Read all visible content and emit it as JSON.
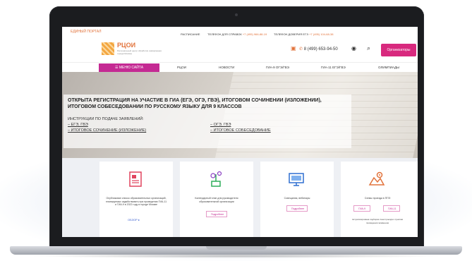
{
  "topbar": {
    "tagline": "ЕДИНЫЙ ПОРТАЛ",
    "schedule": "РАСПИСАНИЕ",
    "hotline_label": "ТЕЛЕФОН ДЛЯ СПРАВОК",
    "hotline_number": "+7 (495) 966-88-19",
    "trust_label": "ТЕЛЕФОН ДОВЕРИЯ ЕГЭ",
    "trust_number": "+7 (495) 104-68-38"
  },
  "header": {
    "logo_title": "РЦОИ",
    "logo_subtitle": "Региональный центр обработки информации города Москвы",
    "phone_number": "8 (499) 653-94-50",
    "organizers_button": "Организаторы"
  },
  "nav": {
    "menu_button": "МЕНЮ САЙТА",
    "items": [
      "РЦОИ",
      "НОВОСТИ",
      "ГИА-9 ОГЭ/ГВЭ",
      "ГИА-11 ЕГЭ/ГВЭ",
      "ОЛИМПИАДЫ"
    ]
  },
  "hero": {
    "title": "ОТКРЫТА РЕГИСТРАЦИЯ НА УЧАСТИЕ В ГИА (ЕГЭ, ОГЭ, ГВЭ), ИТОГОВОМ СОЧИНЕНИИ (ИЗЛОЖЕНИИ), ИТОГОВОМ СОБЕСЕДОВАНИИ ПО РУССКОМУ ЯЗЫКУ ДЛЯ 9 КЛАССОВ",
    "instructions_label": "ИНСТРУКЦИИ ПО ПОДАЧЕ ЗАЯВЛЕНИЙ:",
    "links": [
      "– ЕГЭ, ГВЭ",
      "– ИТОГОВОЕ СОЧИНЕНИЕ (ИЗЛОЖЕНИЕ)",
      "– ОГЭ, ГВЭ",
      "– ИТОГОВОЕ СОБЕСЕДОВАНИЕ"
    ]
  },
  "cards": [
    {
      "text": "Опубликован список образовательных организаций, планируемых задействовать при проведении ГИА-11 и ГИА-9 в 2022 году в городе Москве",
      "link": "ОБЗОР ▸"
    },
    {
      "text": "Календарный план для руководителя образовательной организации",
      "button": "Подробнее"
    },
    {
      "text": "Совещания, вебинары",
      "button": "Подробнее"
    },
    {
      "text": "Схемы проезда в ППЭ",
      "button_a": "ГИА-9",
      "button_b": "ГИА-11",
      "note": "Актуализирована подборка схем проезда к пунктам проведения экзаменов"
    }
  ],
  "colors": {
    "accent_orange": "#e2733b",
    "accent_magenta": "#c42a93",
    "link_blue": "#3a5fd0"
  }
}
